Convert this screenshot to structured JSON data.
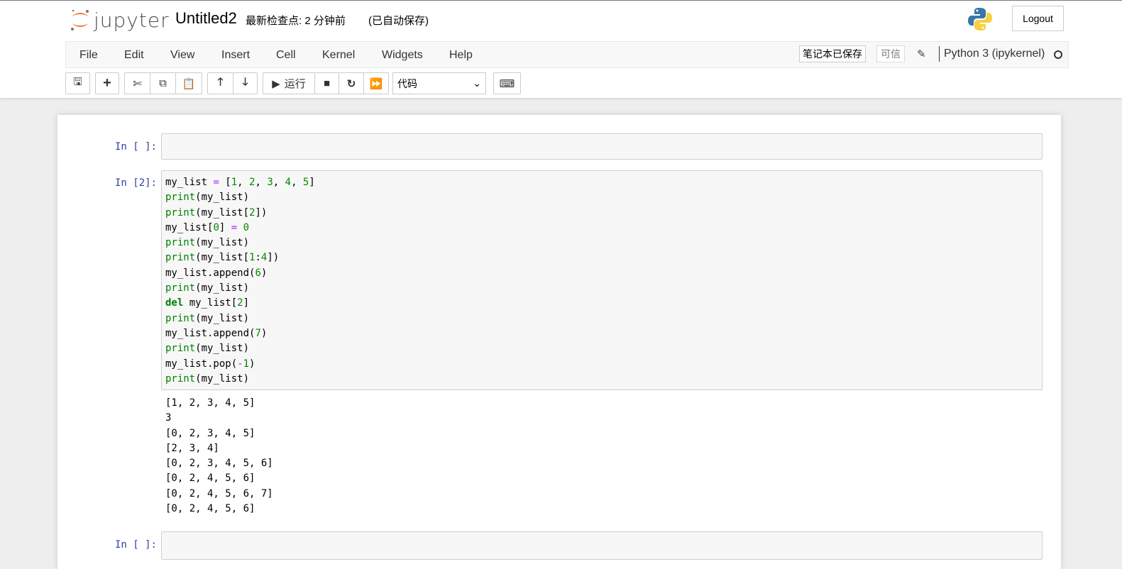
{
  "header": {
    "logo_text": "jupyter",
    "title": "Untitled2",
    "checkpoint": "最新检查点: 2 分钟前",
    "autosave": "(已自动保存)",
    "logout": "Logout"
  },
  "menu": [
    "File",
    "Edit",
    "View",
    "Insert",
    "Cell",
    "Kernel",
    "Widgets",
    "Help"
  ],
  "status": {
    "saved": "笔记本已保存",
    "trusted": "可信",
    "kernel": "Python 3 (ipykernel)"
  },
  "toolbar": {
    "run_label": "运行",
    "cell_type": "代码"
  },
  "cells": [
    {
      "prompt": "In [ ]:"
    },
    {
      "prompt": "In [2]:",
      "code": [
        [
          [
            "n",
            "my_list "
          ],
          [
            "o",
            "="
          ],
          [
            "n",
            " ["
          ],
          [
            "m",
            "1"
          ],
          [
            "n",
            ", "
          ],
          [
            "m",
            "2"
          ],
          [
            "n",
            ", "
          ],
          [
            "m",
            "3"
          ],
          [
            "n",
            ", "
          ],
          [
            "m",
            "4"
          ],
          [
            "n",
            ", "
          ],
          [
            "m",
            "5"
          ],
          [
            "n",
            "]"
          ]
        ],
        [
          [
            "b",
            "print"
          ],
          [
            "n",
            "(my_list)"
          ]
        ],
        [
          [
            "b",
            "print"
          ],
          [
            "n",
            "(my_list["
          ],
          [
            "m",
            "2"
          ],
          [
            "n",
            "])"
          ]
        ],
        [
          [
            "n",
            "my_list["
          ],
          [
            "m",
            "0"
          ],
          [
            "n",
            "] "
          ],
          [
            "o",
            "="
          ],
          [
            "n",
            " "
          ],
          [
            "m",
            "0"
          ]
        ],
        [
          [
            "b",
            "print"
          ],
          [
            "n",
            "(my_list)"
          ]
        ],
        [
          [
            "b",
            "print"
          ],
          [
            "n",
            "(my_list["
          ],
          [
            "m",
            "1"
          ],
          [
            "n",
            ":"
          ],
          [
            "m",
            "4"
          ],
          [
            "n",
            "])"
          ]
        ],
        [
          [
            "n",
            "my_list.append("
          ],
          [
            "m",
            "6"
          ],
          [
            "n",
            ")"
          ]
        ],
        [
          [
            "b",
            "print"
          ],
          [
            "n",
            "(my_list)"
          ]
        ],
        [
          [
            "k",
            "del"
          ],
          [
            "n",
            " my_list["
          ],
          [
            "m",
            "2"
          ],
          [
            "n",
            "]"
          ]
        ],
        [
          [
            "b",
            "print"
          ],
          [
            "n",
            "(my_list)"
          ]
        ],
        [
          [
            "n",
            "my_list.append("
          ],
          [
            "m",
            "7"
          ],
          [
            "n",
            ")"
          ]
        ],
        [
          [
            "b",
            "print"
          ],
          [
            "n",
            "(my_list)"
          ]
        ],
        [
          [
            "n",
            "my_list.pop("
          ],
          [
            "o",
            "-"
          ],
          [
            "m",
            "1"
          ],
          [
            "n",
            ")"
          ]
        ],
        [
          [
            "b",
            "print"
          ],
          [
            "n",
            "(my_list)"
          ]
        ]
      ],
      "output": [
        "[1, 2, 3, 4, 5]",
        "3",
        "[0, 2, 3, 4, 5]",
        "[2, 3, 4]",
        "[0, 2, 3, 4, 5, 6]",
        "[0, 2, 4, 5, 6]",
        "[0, 2, 4, 5, 6, 7]",
        "[0, 2, 4, 5, 6]"
      ]
    },
    {
      "prompt": "In [ ]:"
    }
  ]
}
